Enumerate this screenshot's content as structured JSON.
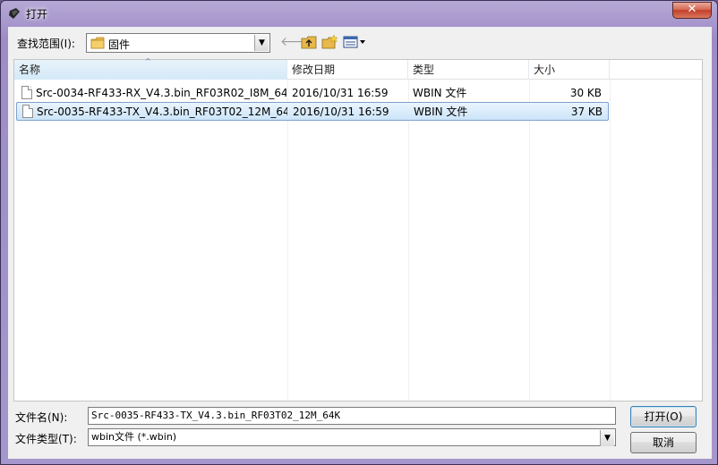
{
  "window": {
    "title": "打开",
    "close_label": "✕"
  },
  "toolbar": {
    "lookin_label": "查找范围(I):",
    "lookin_value": "固件",
    "back_icon": "back-arrow-icon",
    "up_icon": "up-folder-icon",
    "newfolder_icon": "new-folder-icon",
    "views_icon": "views-menu-icon"
  },
  "list": {
    "columns": [
      "名称",
      "修改日期",
      "类型",
      "大小"
    ],
    "rows": [
      {
        "name": "Src-0034-RF433-RX_V4.3.bin_RF03R02_I8M_64...",
        "date": "2016/10/31 16:59",
        "type": "WBIN 文件",
        "size": "30 KB",
        "selected": false
      },
      {
        "name": "Src-0035-RF433-TX_V4.3.bin_RF03T02_12M_64...",
        "date": "2016/10/31 16:59",
        "type": "WBIN 文件",
        "size": "37 KB",
        "selected": true
      }
    ]
  },
  "footer": {
    "filename_label": "文件名(N):",
    "filename_value": "Src-0035-RF433-TX_V4.3.bin_RF03T02_12M_64K",
    "filetype_label": "文件类型(T):",
    "filetype_value": "wbin文件 (*.wbin)",
    "open_label": "打开(O)",
    "cancel_label": "取消"
  },
  "colors": {
    "frame": "#a597cc",
    "selection": "#cde5fa",
    "selection_border": "#7da2ce",
    "close": "#c3402a"
  }
}
